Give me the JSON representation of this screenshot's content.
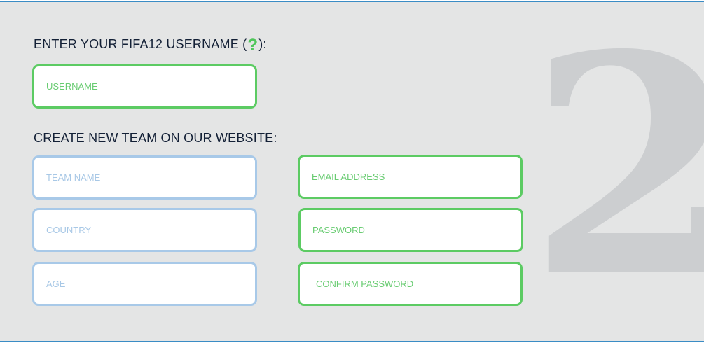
{
  "step_number": "2",
  "username_section": {
    "heading_prefix": "ENTER YOUR FIFA12 USERNAME (",
    "help_icon": "?",
    "heading_suffix": "):",
    "username_placeholder": "USERNAME"
  },
  "team_section": {
    "heading": "CREATE NEW TEAM ON OUR WEBSITE:",
    "team_name_placeholder": "TEAM NAME",
    "country_placeholder": "COUNTRY",
    "age_placeholder": "AGE",
    "email_placeholder": "EMAIL ADDRESS",
    "password_placeholder": "PASSWORD",
    "confirm_password_placeholder": "CONFIRM PASSWORD"
  },
  "colors": {
    "panel_background": "#e4e5e5",
    "green_border": "#5ccb63",
    "blue_border": "#a8c9e8",
    "heading_text": "#132036",
    "step_number": "#ccced0"
  }
}
